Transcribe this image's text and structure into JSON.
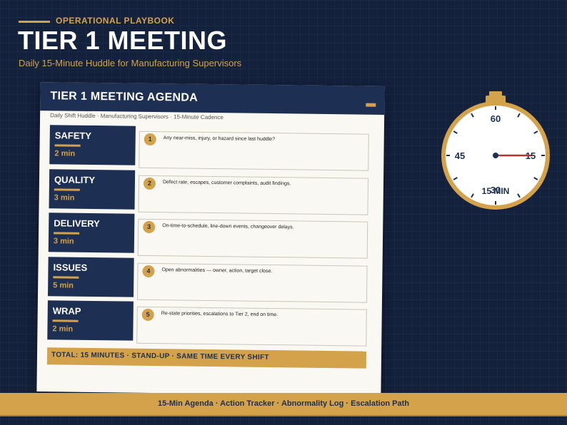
{
  "header": {
    "eyebrow": "OPERATIONAL PLAYBOOK",
    "title": "TIER 1 MEETING",
    "subtitle": "Daily 15-Minute Huddle for Manufacturing Supervisors"
  },
  "agenda": {
    "title": "TIER 1 MEETING AGENDA",
    "meta": "Daily Shift Huddle  ·  Manufacturing Supervisors  ·  15-Minute Cadence",
    "items": [
      {
        "label": "SAFETY",
        "time": "2 min",
        "num": "1",
        "desc": "Any near-miss, injury, or hazard since last huddle?"
      },
      {
        "label": "QUALITY",
        "time": "3 min",
        "num": "2",
        "desc": "Defect rate, escapes, customer complaints, audit findings."
      },
      {
        "label": "DELIVERY",
        "time": "3 min",
        "num": "3",
        "desc": "On-time-to-schedule, line-down events, changeover delays."
      },
      {
        "label": "ISSUES",
        "time": "5 min",
        "num": "4",
        "desc": "Open abnormalities — owner, action, target close."
      },
      {
        "label": "WRAP",
        "time": "2 min",
        "num": "5",
        "desc": "Re-state priorities, escalations to Tier 2, end on time."
      }
    ],
    "total": "TOTAL: 15 MINUTES  ·  STAND-UP  ·  SAME TIME EVERY SHIFT"
  },
  "stopwatch": {
    "labels": {
      "top": "60",
      "right": "15",
      "bottom": "30",
      "left": "45"
    },
    "caption": "15 MIN",
    "hand_minutes": 15
  },
  "footer": {
    "text": "15-Min Agenda  ·  Action Tracker  ·  Abnormality Log  ·  Escalation Path"
  },
  "colors": {
    "navy": "#14213d",
    "panel_navy": "#1d2f52",
    "gold": "#d4a24a",
    "paper": "#faf8f2",
    "hand_red": "#b83232"
  }
}
